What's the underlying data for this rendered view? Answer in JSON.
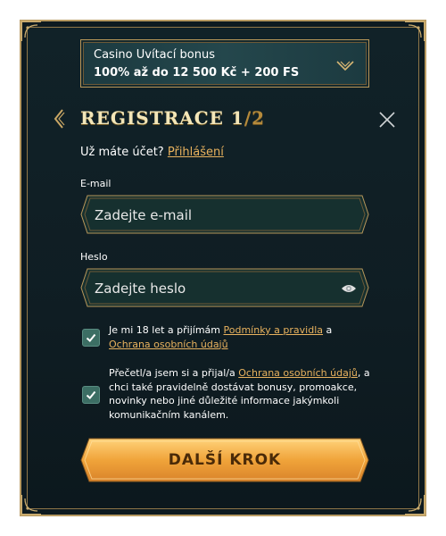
{
  "bonus": {
    "title": "Casino Uvítací bonus",
    "offer": "100% až do 12 500 Kč + 200 FS"
  },
  "header": {
    "title_main": "REGISTRACE 1",
    "title_sep": "/",
    "title_total": "2"
  },
  "login": {
    "question": "Už máte účet?",
    "link": "Přihlášení"
  },
  "email": {
    "label": "E-mail",
    "placeholder": "Zadejte e-mail",
    "value": ""
  },
  "password": {
    "label": "Heslo",
    "placeholder": "Zadejte heslo",
    "value": ""
  },
  "consent_age": {
    "text_before": "Je mi 18 let a přijímám",
    "link1": "Podmínky a pravidla",
    "text_mid": "a",
    "link2": "Ochrana osobních údajů",
    "checked": true
  },
  "consent_marketing": {
    "text_before": "Přečetl/a jsem si a přijal/a",
    "link": "Ochrana osobních údajů",
    "text_after": ", a chci také pravidelně dostávat bonusy, promoakce, novinky nebo jiné důležité informace jakýmkoli komunikačním kanálem.",
    "checked": true
  },
  "cta": {
    "label": "DALŠÍ KROK"
  },
  "colors": {
    "background": "#112228",
    "gold": "#b8975a",
    "accent_link": "#e8b25e",
    "checkbox": "#3c6e64",
    "cta": "#f0a43a"
  }
}
